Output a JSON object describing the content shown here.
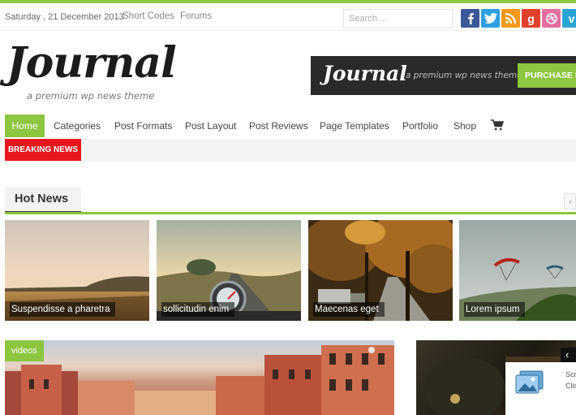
{
  "colors": {
    "accent": "#8dc63f",
    "breaking": "#e8161c",
    "dark": "#2a2a2a"
  },
  "topbar": {
    "date": "Saturday , 21 December 2013",
    "links": [
      "Short Codes",
      "Forums"
    ],
    "search_placeholder": "Search ...",
    "social": [
      {
        "name": "facebook-icon",
        "glyph": "f",
        "color": "#3b5998"
      },
      {
        "name": "twitter-icon",
        "glyph": "t",
        "color": "#2e9fe0"
      },
      {
        "name": "rss-icon",
        "glyph": "rss",
        "color": "#f39a1e"
      },
      {
        "name": "google-plus-icon",
        "glyph": "g",
        "color": "#e0412c"
      },
      {
        "name": "dribbble-icon",
        "glyph": "◎",
        "color": "#e46fa0"
      },
      {
        "name": "vimeo-icon",
        "glyph": "v",
        "color": "#2aa4d5"
      }
    ]
  },
  "header": {
    "logo": "Journal",
    "tagline": "a premium wp news theme",
    "banner": {
      "logo": "Journal",
      "subtitle": "a premium wp news theme",
      "button": "PURCHASE N"
    }
  },
  "nav": {
    "items": [
      "Home",
      "Categories",
      "Post Formats",
      "Post Layout",
      "Post Reviews",
      "Page Templates",
      "Portfolio",
      "Shop"
    ],
    "active_index": 0,
    "cart_icon": "shopping-cart-icon"
  },
  "breaking": {
    "label": "BREAKING NEWS"
  },
  "hot_news": {
    "title": "Hot News",
    "items": [
      {
        "caption": "Suspendisse a pharetra"
      },
      {
        "caption": "sollicitudin enim"
      },
      {
        "caption": "Maecenas eget"
      },
      {
        "caption": "Lorem ipsum"
      }
    ]
  },
  "videos": {
    "tag": "videos"
  },
  "popup": {
    "text_line1": "Scr",
    "text_line2": "Clic"
  }
}
